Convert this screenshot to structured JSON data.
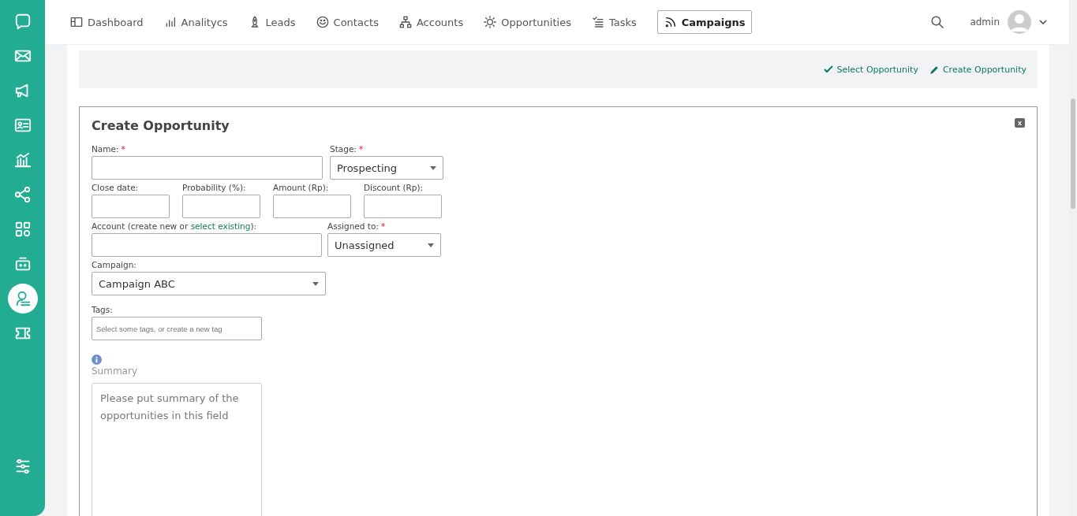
{
  "sidebar": {
    "items": [
      {
        "selected": false
      },
      {
        "selected": false
      },
      {
        "selected": false
      },
      {
        "selected": false
      },
      {
        "selected": false
      },
      {
        "selected": false
      },
      {
        "selected": false
      },
      {
        "selected": false
      },
      {
        "selected": true
      },
      {
        "selected": false
      }
    ]
  },
  "nav": {
    "items": [
      {
        "label": "Dashboard",
        "selected": false
      },
      {
        "label": "Analitycs",
        "selected": false
      },
      {
        "label": "Leads",
        "selected": false
      },
      {
        "label": "Contacts",
        "selected": false
      },
      {
        "label": "Accounts",
        "selected": false
      },
      {
        "label": "Opportunities",
        "selected": false
      },
      {
        "label": "Tasks",
        "selected": false
      },
      {
        "label": "Campaigns",
        "selected": true
      }
    ],
    "user": "admin"
  },
  "actions": [
    {
      "label": "Select Opportunity"
    },
    {
      "label": "Create Opportunity"
    }
  ],
  "form": {
    "title": "Create Opportunity",
    "close": "x",
    "name": {
      "label": "Name:",
      "required_mark": "*"
    },
    "stage": {
      "label": "Stage:",
      "required_mark": "*",
      "value": "Prospecting"
    },
    "numbers": [
      {
        "label": "Close date:"
      },
      {
        "label": "Probability (%):"
      },
      {
        "label": "Amount (Rp):"
      },
      {
        "label": "Discount (Rp):"
      }
    ],
    "account": {
      "label_start": "Account (create new or",
      "link": "select existing",
      "label_end": "):"
    },
    "assigned": {
      "label": "Assigned to:",
      "required_mark": "*",
      "value": "Unassigned"
    },
    "campaign": {
      "label": "Campaign:",
      "value": "Campaign ABC"
    },
    "tags": {
      "label": "Tags:",
      "placeholder": "Select some tags, or create a new tag"
    },
    "summary": {
      "label": "Summary",
      "placeholder": "Please put summary of the opportunities in this field"
    }
  }
}
